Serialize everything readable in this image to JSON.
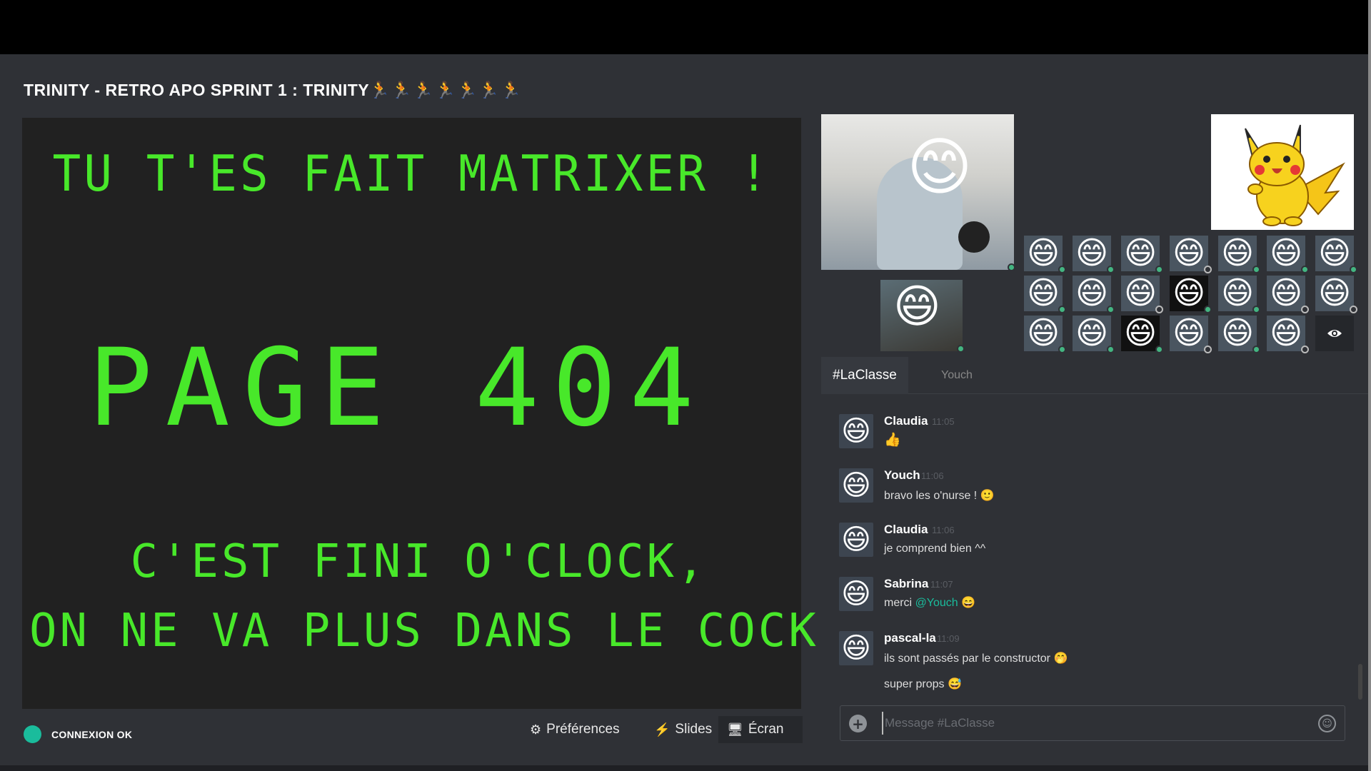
{
  "header": {
    "title": "TRINITY - RETRO APO SPRINT 1 : TRINITY",
    "title_runners": "🏃🏃🏃🏃🏃🏃🏃"
  },
  "screen": {
    "line1": "TU T'ES FAIT MATRIXER !",
    "line2": "PAGE 404",
    "line3": "C'EST FINI O'CLOCK,",
    "line4": "ON NE VA PLUS DANS LE COCKPIT",
    "text_color": "#48e82a"
  },
  "status": {
    "label": "CONNEXION OK",
    "color": "#1abc9c"
  },
  "footer": {
    "preferences_label": "Préférences",
    "preferences_icon": "gear-icon",
    "slides_label": "Slides",
    "slides_icon": "bolt-icon",
    "screen_label": "Écran",
    "screen_icon": "monitor-icon"
  },
  "participants": {
    "main_video_emoji": "😊",
    "small_video_emoji": "😄",
    "avatar_emoji": "😄"
  },
  "chat": {
    "tabs": [
      "#LaClasse",
      "Youch"
    ],
    "messages": [
      {
        "author": "Claudia",
        "time": "11:05",
        "lines": [
          "👍"
        ]
      },
      {
        "author": "Youch",
        "time": "11:06",
        "lines": [
          "bravo les o'nurse ! 🙂"
        ]
      },
      {
        "author": "Claudia",
        "time": "11:06",
        "lines": [
          "je comprend bien ^^"
        ]
      },
      {
        "author": "Sabrina",
        "time": "11:07",
        "text_before": "merci ",
        "mention": "@Youch",
        "text_after": " 😄"
      },
      {
        "author": "pascal-la",
        "time": "11:09",
        "lines": [
          "ils sont passés par le constructor 🤭",
          "super props 😅"
        ]
      }
    ],
    "composer_placeholder": "Message #LaClasse"
  },
  "colors": {
    "background": "#2f3136",
    "accent": "#1abc9c",
    "online": "#43b581"
  }
}
